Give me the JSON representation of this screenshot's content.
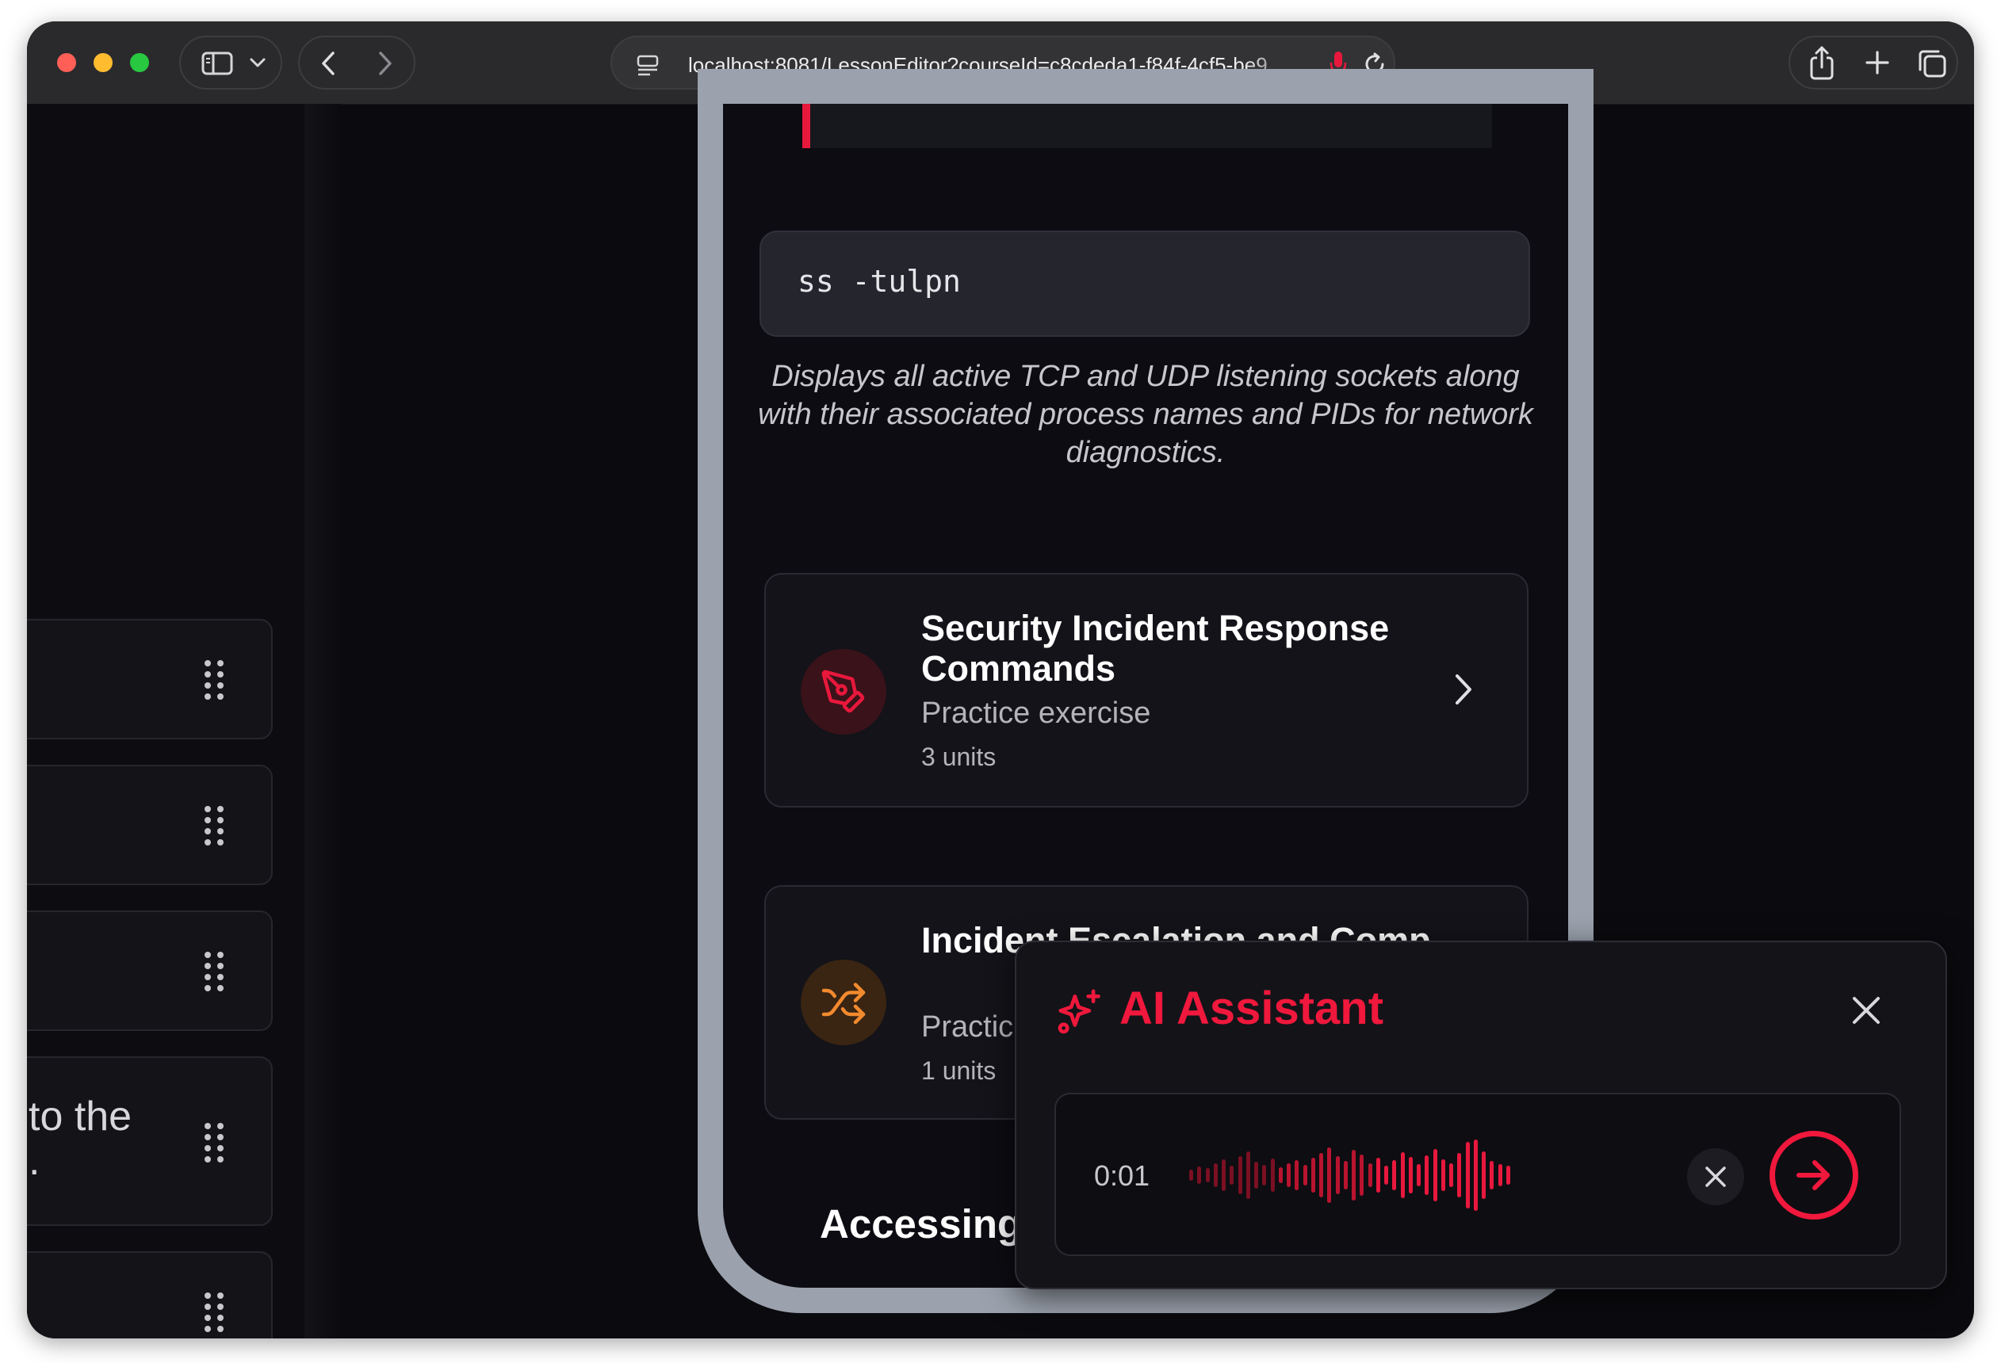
{
  "browser": {
    "url": "localhost:8081/LessonEditor?courseId=c8cdeda1-f84f-4cf5-be9",
    "icons": [
      "sidebar-toggle-icon",
      "chevron-down-icon",
      "back-icon",
      "forward-icon",
      "site-settings-icon",
      "microphone-icon",
      "reload-icon",
      "share-icon",
      "new-tab-icon",
      "tabs-overview-icon"
    ]
  },
  "left_panel": {
    "items": [
      {
        "text": ""
      },
      {
        "text": ""
      },
      {
        "text": ""
      },
      {
        "text": "to the",
        "text2": "."
      },
      {
        "text": ""
      }
    ]
  },
  "preview": {
    "code": "ss -tulpn",
    "caption": "Displays all active TCP and UDP listening sockets along with their associated process names and PIDs for network diagnostics.",
    "lessons": [
      {
        "title": "Security Incident Response Commands",
        "subtitle": "Practice exercise",
        "units": "3 units",
        "icon": "pen-tool-icon",
        "color": "#e8183c"
      },
      {
        "title": "Incident Escalation and Comp",
        "subtitle": "Practic",
        "units": "1 units",
        "icon": "shuffle-icon",
        "color": "#f28a2e"
      }
    ],
    "section_heading": "Accessing"
  },
  "ai_assistant": {
    "title": "AI Assistant",
    "icon": "sparkles-icon",
    "recording_time": "0:01",
    "accent": "#f0183c"
  }
}
